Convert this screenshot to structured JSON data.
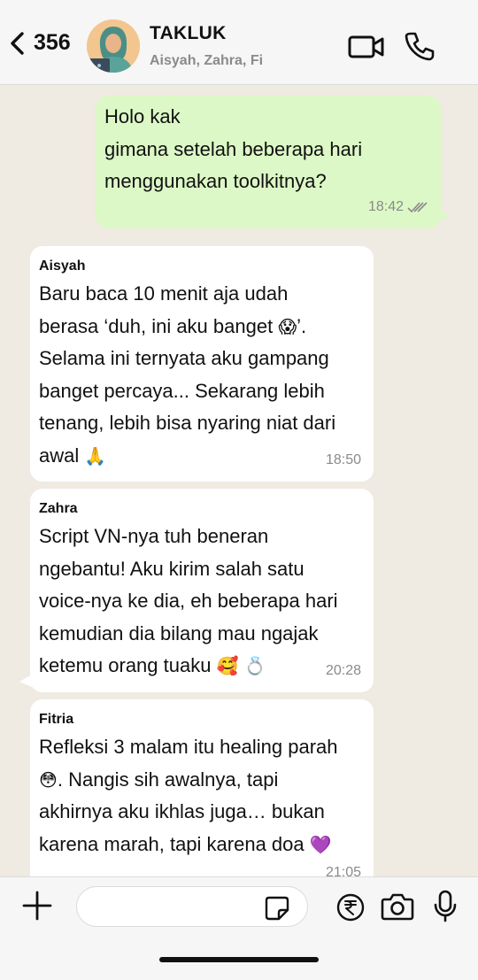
{
  "header": {
    "back_count": "356",
    "title": "TAKLUK",
    "subtitle": "Aisyah, Zahra, Fi"
  },
  "messages": {
    "outgoing": {
      "text": " Holo kak\ngimana setelah beberapa hari\nmenggunakan toolkitnya?",
      "time": "18:42"
    },
    "aisyah": {
      "sender": "Aisyah",
      "text": " Baru baca 10 menit aja udah\nberasa ‘duh, ini aku banget ",
      "emoji1": "😱",
      "text2": "’.\nSelama ini ternyata aku gampang\nbanget percaya... Sekarang lebih\ntenang, lebih bisa nyaring niat dari\nawal ",
      "emoji2": "🙏",
      "time": "18:50"
    },
    "zahra": {
      "sender": "Zahra",
      "text": " Script VN-nya tuh beneran\nngebantu! Aku kirim salah satu\nvoice-nya ke dia, eh beberapa hari\nkemudian dia bilang mau ngajak\nketemu orang tuaku ",
      "emoji1": "🥰",
      "emoji2": "💍",
      "time": "20:28"
    },
    "fitria": {
      "sender": "Fitria",
      "text": " Refleksi 3 malam itu healing parah\n",
      "emoji1": "😳",
      "text2": ". Nangis sih awalnya, tapi\nakhirnya aku ikhlas juga… bukan\nkarena marah, tapi karena doa ",
      "emoji2": "💜",
      "time": "21:05"
    }
  },
  "composer": {
    "placeholder": ""
  },
  "colors": {
    "outgoing_bubble": "#dcf8c6",
    "incoming_bubble": "#ffffff",
    "chat_bg": "#efeae2",
    "read_ticks": "#8a8a8a"
  }
}
